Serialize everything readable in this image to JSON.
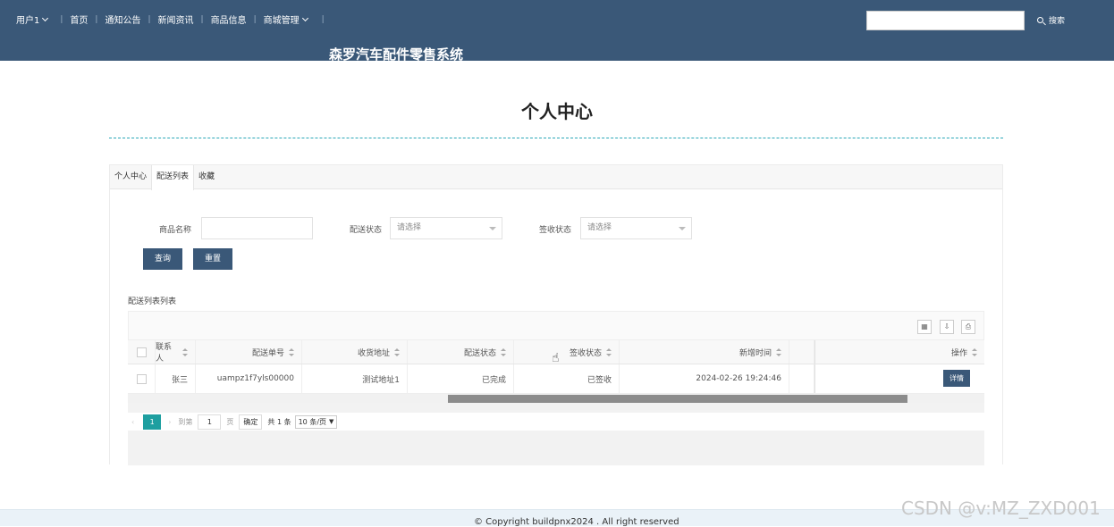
{
  "nav": {
    "user": "用户1",
    "items": [
      "首页",
      "通知公告",
      "新闻资讯",
      "商品信息",
      "商城管理"
    ],
    "search_label": "搜索"
  },
  "site_title": "森罗汽车配件零售系统",
  "page_title": "个人中心",
  "tabs": [
    "个人中心",
    "配送列表",
    "收藏"
  ],
  "filters": {
    "product_name_label": "商品名称",
    "delivery_status_label": "配送状态",
    "delivery_status_placeholder": "请选择",
    "sign_status_label": "签收状态",
    "sign_status_placeholder": "请选择",
    "query_button": "查询",
    "reset_button": "重置"
  },
  "list_title": "配送列表列表",
  "table": {
    "headers": [
      "联系人",
      "配送单号",
      "收货地址",
      "配送状态",
      "签收状态",
      "新增时间",
      "操作"
    ],
    "rows": [
      {
        "contact": "张三",
        "order_no": "uampz1f7yls00000",
        "address": "测试地址1",
        "delivery_status": "已完成",
        "sign_status": "已签收",
        "created": "2024-02-26 19:24:46",
        "action": "详情"
      }
    ]
  },
  "pager": {
    "current": "1",
    "goto_label": "到第",
    "page_input": "1",
    "page_unit": "页",
    "confirm": "确定",
    "total": "共 1 条",
    "page_size": "10 条/页"
  },
  "footer": "© Copyright buildpnx2024 . All right reserved",
  "watermark": "CSDN @v:MZ_ZXD001"
}
